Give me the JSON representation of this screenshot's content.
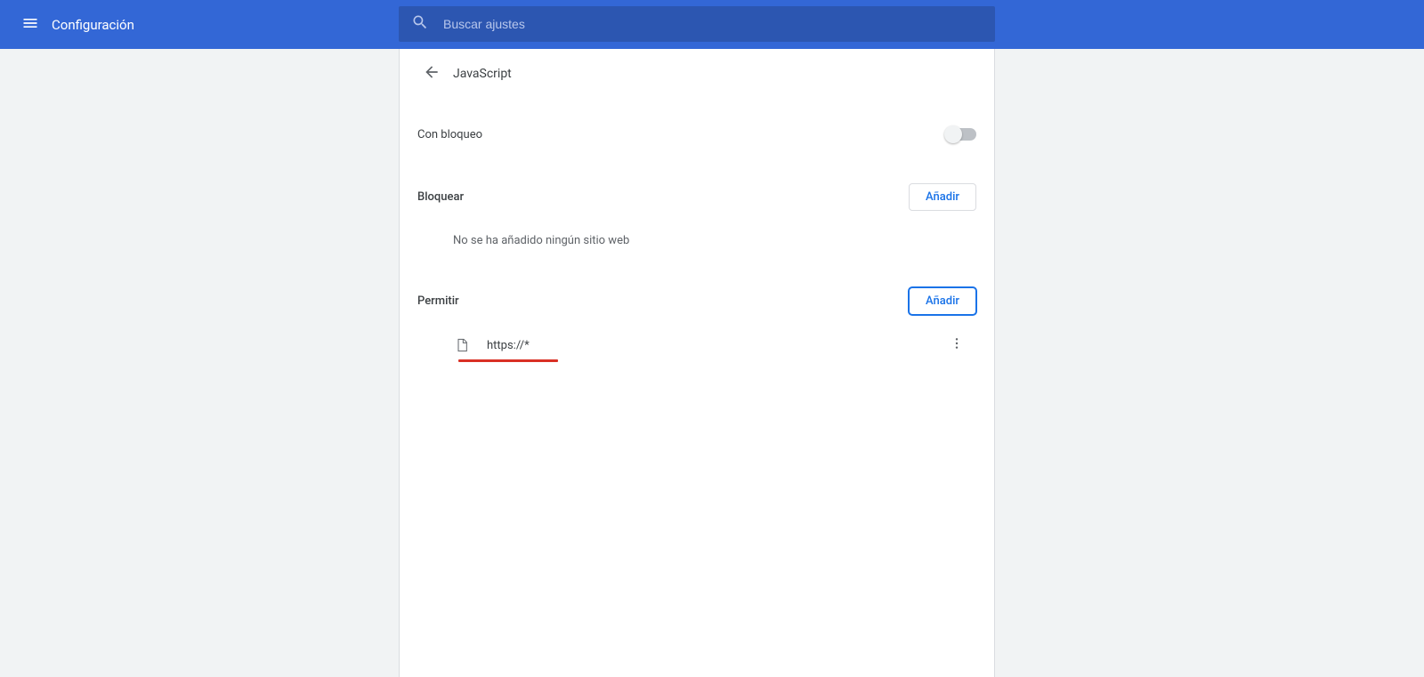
{
  "header": {
    "title": "Configuración",
    "search_placeholder": "Buscar ajustes"
  },
  "page": {
    "title": "JavaScript"
  },
  "toggle": {
    "label": "Con bloqueo",
    "enabled": false
  },
  "block_section": {
    "title": "Bloquear",
    "add_label": "Añadir",
    "empty_message": "No se ha añadido ningún sitio web"
  },
  "allow_section": {
    "title": "Permitir",
    "add_label": "Añadir",
    "items": [
      {
        "url": "https://*"
      }
    ]
  },
  "colors": {
    "header_bg": "#3367d6",
    "accent": "#1a73e8",
    "annotation": "#d93025"
  }
}
